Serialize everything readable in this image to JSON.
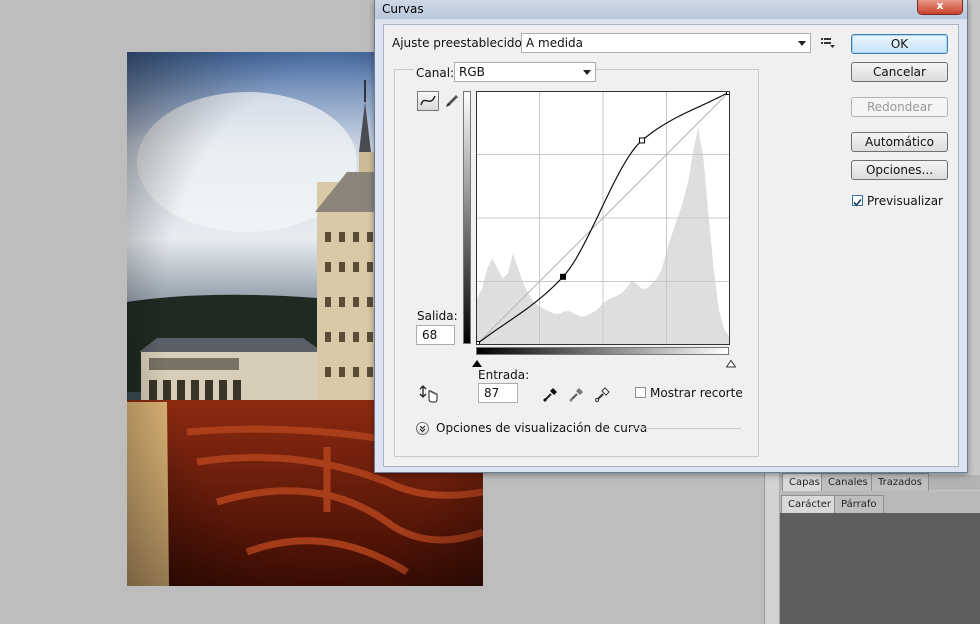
{
  "dialog": {
    "title": "Curvas",
    "close_label": "x",
    "preset_label": "Ajuste preestablecido:",
    "preset_value": "A medida",
    "channel_label": "Canal:",
    "channel_value": "RGB",
    "output_label": "Salida:",
    "output_value": "68",
    "input_label": "Entrada:",
    "input_value": "87",
    "show_clipping_label": "Mostrar recorte",
    "show_clipping_checked": false,
    "curve_display_options_label": "Opciones de visualización de curva",
    "preview_label": "Previsualizar",
    "preview_checked": true
  },
  "buttons": {
    "ok": "OK",
    "cancel": "Cancelar",
    "smooth": "Redondear",
    "auto": "Automático",
    "options": "Opciones..."
  },
  "panels": {
    "tabs_row1": [
      "Capas",
      "Canales",
      "Trazados"
    ],
    "tabs_row2": [
      "Carácter",
      "Párrafo"
    ]
  },
  "curve": {
    "input_axis_range": [
      0,
      255
    ],
    "output_axis_range": [
      0,
      255
    ],
    "points": [
      {
        "input": 0,
        "output": 0
      },
      {
        "input": 87,
        "output": 68
      },
      {
        "input": 167,
        "output": 206
      },
      {
        "input": 255,
        "output": 255
      }
    ],
    "selected_point_index": 1,
    "histogram": [
      0.18,
      0.22,
      0.3,
      0.34,
      0.3,
      0.26,
      0.28,
      0.36,
      0.3,
      0.24,
      0.2,
      0.17,
      0.15,
      0.14,
      0.13,
      0.12,
      0.12,
      0.13,
      0.13,
      0.12,
      0.11,
      0.11,
      0.12,
      0.13,
      0.15,
      0.17,
      0.18,
      0.19,
      0.2,
      0.22,
      0.25,
      0.24,
      0.22,
      0.22,
      0.24,
      0.26,
      0.3,
      0.38,
      0.44,
      0.5,
      0.56,
      0.64,
      0.76,
      0.86,
      0.74,
      0.52,
      0.3,
      0.14,
      0.06,
      0.03
    ]
  },
  "colors": {
    "dialog_bg": "#f0f0f0",
    "titlebar": "#c4d1e1",
    "close_button": "#c8432b",
    "grid_line": "#c8c8c8",
    "histogram_fill": "#dedede"
  },
  "icons": {
    "curve_tool": "curve-point-tool-icon",
    "pencil_tool": "pencil-icon",
    "target_adjust": "hand-adjust-icon",
    "black_eyedropper": "eyedropper-black-icon",
    "gray_eyedropper": "eyedropper-gray-icon",
    "white_eyedropper": "eyedropper-white-icon",
    "preset_menu": "preset-menu-icon",
    "expand": "expand-chevron-icon"
  }
}
